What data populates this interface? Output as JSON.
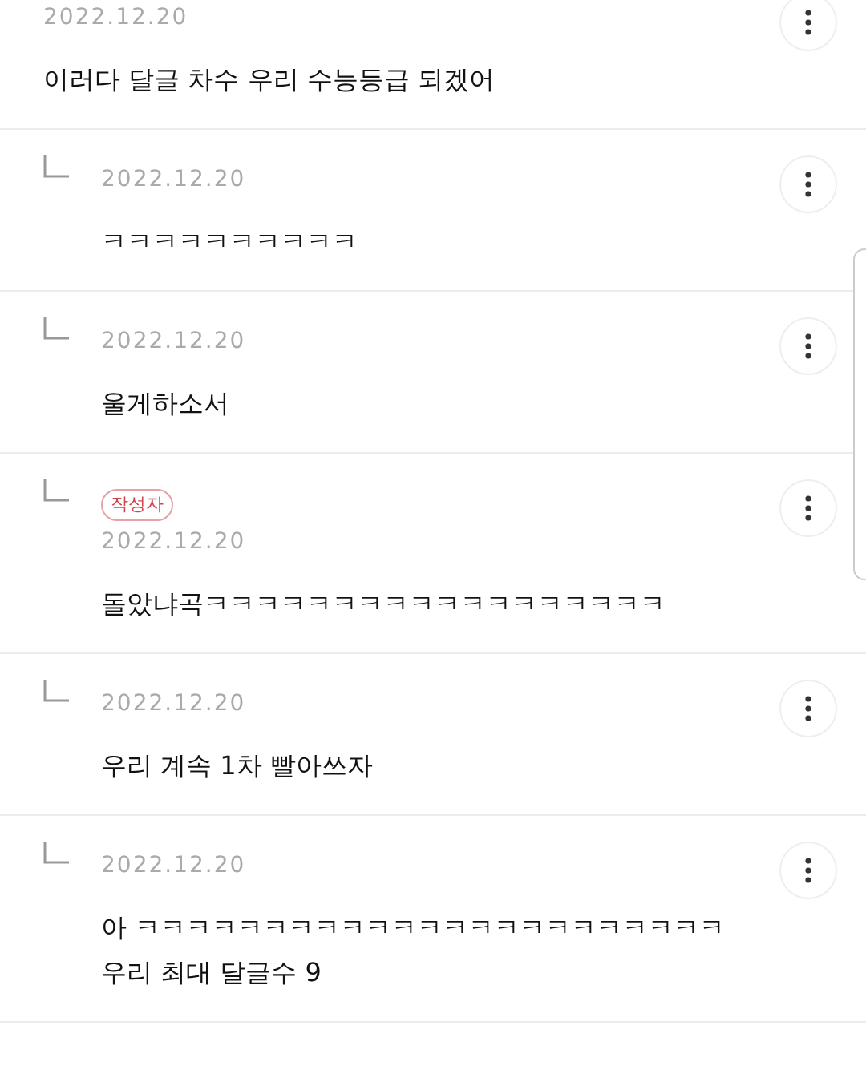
{
  "comments": [
    {
      "kind": "comment",
      "date": "2022.12.20",
      "text": "이러다 달글 차수 우리 수능등급 되겠어"
    },
    {
      "kind": "reply",
      "date": "2022.12.20",
      "text": "ㅋㅋㅋㅋㅋㅋㅋㅋㅋㅋ"
    },
    {
      "kind": "reply",
      "date": "2022.12.20",
      "text": "울게하소서"
    },
    {
      "kind": "reply",
      "badge": "작성자",
      "date": "2022.12.20",
      "text": "돌았냐곡ㅋㅋㅋㅋㅋㅋㅋㅋㅋㅋㅋㅋㅋㅋㅋㅋㅋㅋ"
    },
    {
      "kind": "reply",
      "date": "2022.12.20",
      "text": "우리 계속 1차 빨아쓰자"
    },
    {
      "kind": "reply",
      "date": "2022.12.20",
      "text": "아 ㅋㅋㅋㅋㅋㅋㅋㅋㅋㅋㅋㅋㅋㅋㅋㅋㅋㅋㅋㅋㅋㅋㅋ\n우리 최대 달글수 9"
    }
  ]
}
